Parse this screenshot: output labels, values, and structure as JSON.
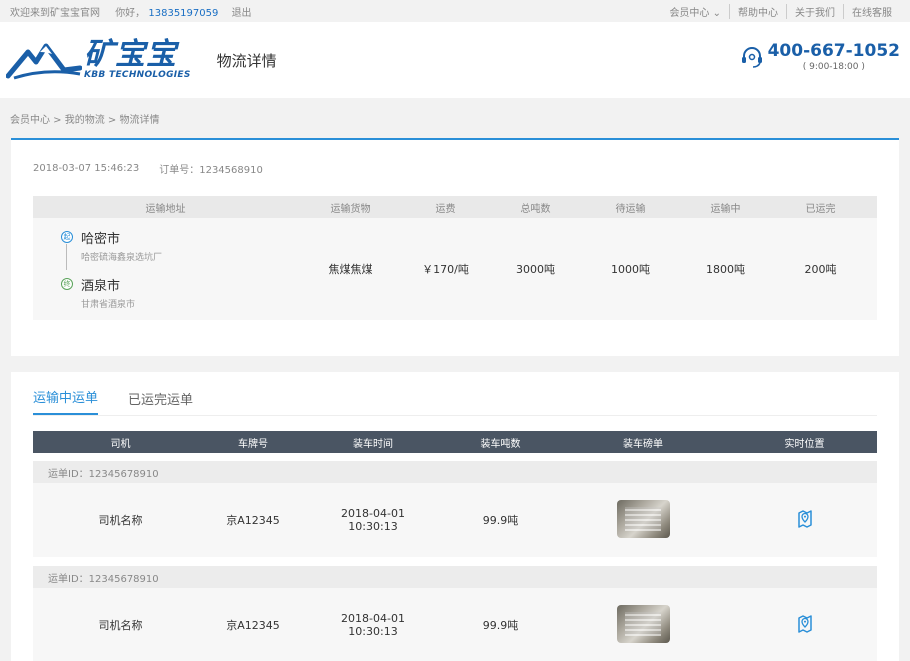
{
  "topbar": {
    "welcome": "欢迎来到矿宝宝官网",
    "greeting": "你好，",
    "phone": "13835197059",
    "logout": "退出",
    "links": [
      "会员中心 ⌄",
      "帮助中心",
      "关于我们",
      "在线客服"
    ]
  },
  "header": {
    "logo_cn": "矿宝宝",
    "logo_en": "KBB TECHNOLOGIES",
    "page_title": "物流详情",
    "hotline": "400-667-1052",
    "hours": "( 9:00-18:00 )"
  },
  "breadcrumb": "会员中心 > 我的物流 > 物流详情",
  "summary": {
    "datetime": "2018-03-07  15:46:23",
    "order_label": "订单号：1234568910",
    "headers": [
      "运输地址",
      "运输货物",
      "运费",
      "总吨数",
      "待运输",
      "运输中",
      "已运完"
    ],
    "from_badge": "起",
    "from_city": "哈密市",
    "from_addr": "哈密硫海鑫泉选坑厂",
    "to_badge": "终",
    "to_city": "酒泉市",
    "to_addr": "甘肃省酒泉市",
    "goods": "焦煤焦煤",
    "fee": "￥170/吨",
    "total": "3000吨",
    "pending": "1000吨",
    "in_transit": "1800吨",
    "done": "200吨"
  },
  "waybills": {
    "tabs": [
      "运输中运单",
      "已运完运单"
    ],
    "headers": [
      "司机",
      "车牌号",
      "装车时间",
      "装车吨数",
      "装车磅单",
      "实时位置"
    ],
    "groups": [
      {
        "id_label": "运单ID：12345678910",
        "driver": "司机名称",
        "plate": "京A12345",
        "date": "2018-04-01",
        "time": "10:30:13",
        "tons": "99.9吨"
      },
      {
        "id_label": "运单ID：12345678910",
        "driver": "司机名称",
        "plate": "京A12345",
        "date": "2018-04-01",
        "time": "10:30:13",
        "tons": "99.9吨"
      }
    ]
  },
  "colors": {
    "accent": "#2a8fd8",
    "brand": "#1a5fa8",
    "table_head": "#4a5563"
  }
}
